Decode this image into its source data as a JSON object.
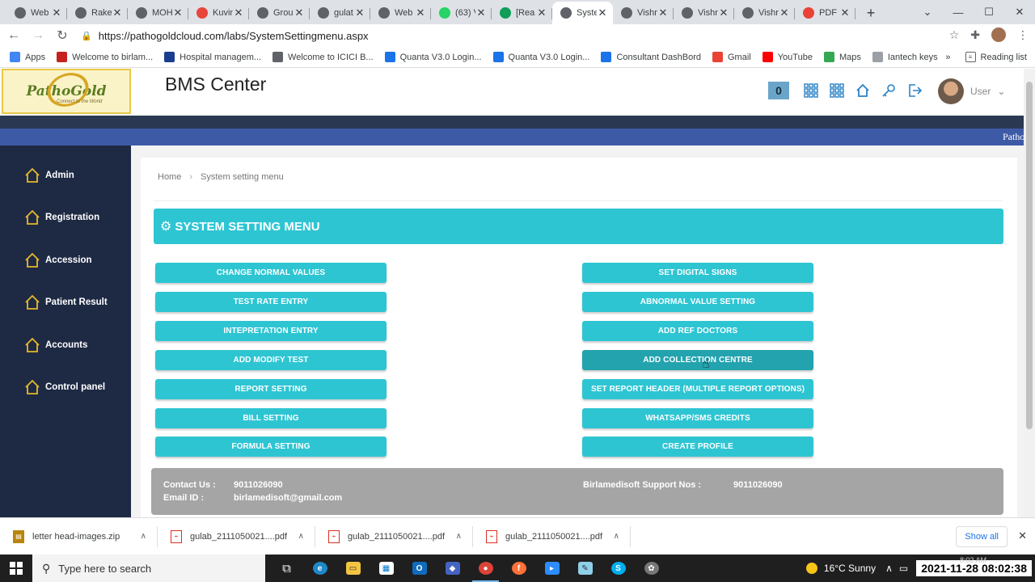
{
  "browser": {
    "tabs": [
      {
        "label": "Web",
        "fav_color": "#5f6368",
        "active": false
      },
      {
        "label": "Rake",
        "fav_color": "#5f6368",
        "active": false
      },
      {
        "label": "MOH",
        "fav_color": "#5f6368",
        "active": false
      },
      {
        "label": "Kuvin",
        "fav_color": "#e8453c",
        "active": false
      },
      {
        "label": "Grou",
        "fav_color": "#5f6368",
        "active": false
      },
      {
        "label": "gulat",
        "fav_color": "#5f6368",
        "active": false
      },
      {
        "label": "Web",
        "fav_color": "#5f6368",
        "active": false
      },
      {
        "label": "(63) V",
        "fav_color": "#25d366",
        "active": false
      },
      {
        "label": "[Rea",
        "fav_color": "#0f9d58",
        "active": false
      },
      {
        "label": "Syste",
        "fav_color": "#5f6368",
        "active": true
      },
      {
        "label": "Vishr",
        "fav_color": "#5f6368",
        "active": false
      },
      {
        "label": "Vishr",
        "fav_color": "#5f6368",
        "active": false
      },
      {
        "label": "Vishr",
        "fav_color": "#5f6368",
        "active": false
      },
      {
        "label": "PDF",
        "fav_color": "#e94235",
        "active": false
      }
    ],
    "url": "https://pathogoldcloud.com/labs/SystemSettingmenu.aspx",
    "bookmarks": [
      {
        "label": "Apps",
        "fav_color": "#4285f4"
      },
      {
        "label": "Welcome to birlam...",
        "fav_color": "#c5221f"
      },
      {
        "label": "Hospital managem...",
        "fav_color": "#1a3d8f"
      },
      {
        "label": "Welcome to ICICI B...",
        "fav_color": "#5f6368"
      },
      {
        "label": "Quanta V3.0 Login...",
        "fav_color": "#1a73e8"
      },
      {
        "label": "Quanta V3.0 Login...",
        "fav_color": "#1a73e8"
      },
      {
        "label": "Consultant DashBord",
        "fav_color": "#1a73e8"
      },
      {
        "label": "Gmail",
        "fav_color": "#ea4335"
      },
      {
        "label": "YouTube",
        "fav_color": "#ff0000"
      },
      {
        "label": "Maps",
        "fav_color": "#34a853"
      },
      {
        "label": "Iantech keys",
        "fav_color": "#9aa0a6"
      }
    ],
    "reading_list": "Reading list",
    "more_bookmarks": "»"
  },
  "app": {
    "logo_text": "PathoGold",
    "logo_tagline": "Connect to the World",
    "center_title": "BMS Center",
    "notification_count": "0",
    "user_label": "User",
    "marquee_text": "Patho",
    "accent_color": "#2ec5d3",
    "sidebar_color": "#1e2a44"
  },
  "sidebar": {
    "items": [
      {
        "label": "Admin"
      },
      {
        "label": "Registration"
      },
      {
        "label": "Accession"
      },
      {
        "label": "Patient Result"
      },
      {
        "label": "Accounts"
      },
      {
        "label": "Control panel"
      }
    ]
  },
  "breadcrumb": {
    "home": "Home",
    "current": "System setting menu"
  },
  "section": {
    "title": "SYSTEM SETTING MENU"
  },
  "buttons": {
    "left": [
      "CHANGE NORMAL VALUES",
      "TEST RATE ENTRY",
      "INTEPRETATION ENTRY",
      "ADD MODIFY TEST",
      "REPORT SETTING",
      "BILL SETTING",
      "FORMULA SETTING"
    ],
    "right": [
      "SET DIGITAL SIGNS",
      "ABNORMAL VALUE SETTING",
      "ADD REF DOCTORS",
      "ADD COLLECTION CENTRE",
      "SET REPORT HEADER (MULTIPLE REPORT OPTIONS)",
      "WHATSAPP/SMS CREDITS",
      "CREATE PROFILE"
    ]
  },
  "footer": {
    "contact_label": "Contact Us :",
    "contact_value": "9011026090",
    "email_label": "Email ID :",
    "email_value": "birlamedisoft@gmail.com",
    "support_label": "Birlamedisoft Support Nos :",
    "support_value": "9011026090"
  },
  "downloads": {
    "items": [
      {
        "name": "letter head-images.zip",
        "type": "zip"
      },
      {
        "name": "gulab_2111050021....pdf",
        "type": "pdf"
      },
      {
        "name": "gulab_2111050021....pdf",
        "type": "pdf"
      },
      {
        "name": "gulab_2111050021....pdf",
        "type": "pdf"
      }
    ],
    "show_all": "Show all"
  },
  "taskbar": {
    "search_placeholder": "Type here to search",
    "weather": "16°C  Sunny",
    "clock": "2021-11-28 08:02:38",
    "clock_small": "8:02 AM"
  }
}
